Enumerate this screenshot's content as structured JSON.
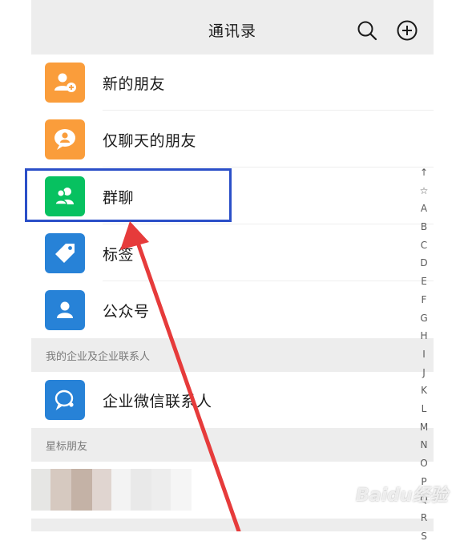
{
  "header": {
    "title": "通讯录",
    "search_icon": "search-icon",
    "add_icon": "plus-circle-icon"
  },
  "menu_items": [
    {
      "label": "新的朋友",
      "icon": "add-friend-icon",
      "color": "#fa9d3b"
    },
    {
      "label": "仅聊天的朋友",
      "icon": "chat-only-friend-icon",
      "color": "#fa9d3b"
    },
    {
      "label": "群聊",
      "icon": "group-chat-icon",
      "color": "#07c160"
    },
    {
      "label": "标签",
      "icon": "tag-icon",
      "color": "#2782d7"
    },
    {
      "label": "公众号",
      "icon": "official-account-icon",
      "color": "#2782d7"
    }
  ],
  "sections": {
    "enterprise": "我的企业及企业联系人",
    "starred": "星标朋友"
  },
  "enterprise_item": {
    "label": "企业微信联系人",
    "icon": "wecom-contact-icon",
    "color": "#2782d7"
  },
  "index_letters": [
    "↑",
    "☆",
    "A",
    "B",
    "C",
    "D",
    "E",
    "F",
    "G",
    "H",
    "I",
    "J",
    "K",
    "L",
    "M",
    "N",
    "O",
    "P",
    "Q",
    "R",
    "S"
  ],
  "annotation": {
    "highlight_color": "#2b4fc8",
    "arrow_color": "#e63b3b"
  },
  "watermark": "Baidu经验"
}
